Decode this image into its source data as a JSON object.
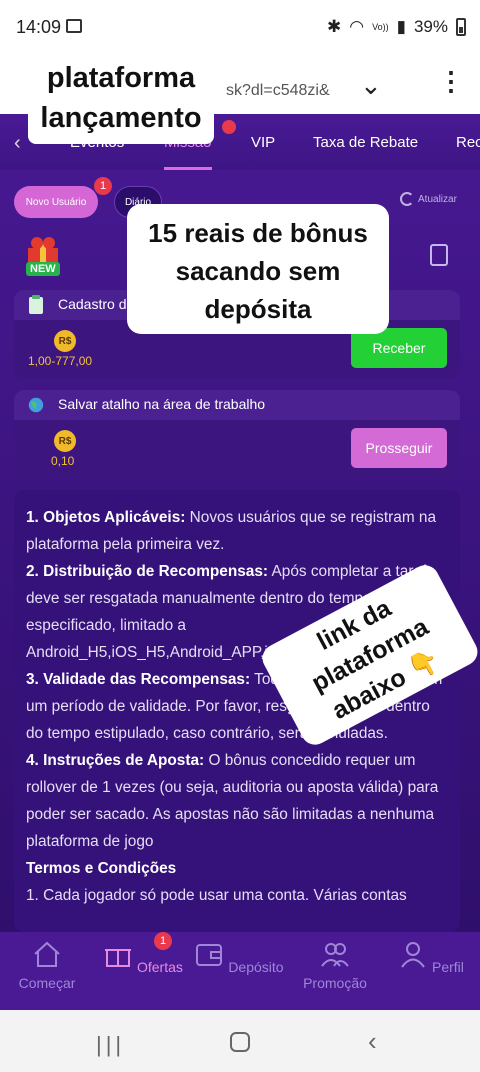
{
  "status_bar": {
    "time": "14:09",
    "network": "Vo))",
    "battery": "39%"
  },
  "browser": {
    "url_fragment": "sk?dl=c548zi&"
  },
  "captions": {
    "top_line1": "plataforma",
    "top_line2": "lançamento",
    "middle_line1": "15 reais de bônus",
    "middle_line2": "sacando sem",
    "middle_line3": "depósita",
    "diagonal_line1": "link da plataforma",
    "diagonal_line2": "abaixo 👇"
  },
  "tabs": [
    {
      "label": "Eventos"
    },
    {
      "label": "Missão",
      "active": true
    },
    {
      "label": "VIP"
    },
    {
      "label": "Taxa de Rebate"
    },
    {
      "label": "Rec"
    }
  ],
  "filters": {
    "new_user": "Novo Usuário",
    "new_user_badge": "1",
    "daily": "Diário",
    "refresh": "Atualizar"
  },
  "new_badge": "NEW",
  "tasks": [
    {
      "title": "Cadastro de conta",
      "coin": "R$",
      "amount": "1,00-777,00",
      "button": "Receber"
    },
    {
      "title": "Salvar atalho na área de trabalho",
      "coin": "R$",
      "amount": "0,10",
      "button": "Prosseguir"
    }
  ],
  "terms": {
    "p1_head": "1. Objetos Aplicáveis:",
    "p1_body": " Novos usuários que se registram na plataforma pela primeira vez.",
    "p2_head": "2. Distribuição de Recompensas:",
    "p2_body": " Após completar a tarefa, deve ser resgatada manualmente dentro do tempo especificado, limitado a Android_H5,iOS_H5,Android_APP,iOS_APP",
    "p3_head": "3. Validade das Recompensas:",
    "p3_body": " Todas as recompensas têm um período de validade. Por favor, resgate ou utilize dentro do tempo estipulado, caso contrário, serão anuladas.",
    "p4_head": "4. Instruções de Aposta:",
    "p4_body": " O bônus concedido requer um rollover de 1 vezes (ou seja, auditoria ou aposta válida) para poder ser sacado. As apostas não são limitadas a nenhuma plataforma de jogo",
    "conditions_head": "Termos e Condições",
    "c1": "1. Cada jogador só pode usar uma conta. Várias contas"
  },
  "bottom_nav": {
    "items": [
      "Começar",
      "Ofertas",
      "Depósito",
      "Promoção",
      "Perfil"
    ],
    "offers_badge": "1"
  },
  "colors": {
    "accent": "#e58be0",
    "background": "#3a1479",
    "green_button": "#23d136",
    "pink_button": "#d36ad6",
    "coin": "#f0b92a"
  }
}
